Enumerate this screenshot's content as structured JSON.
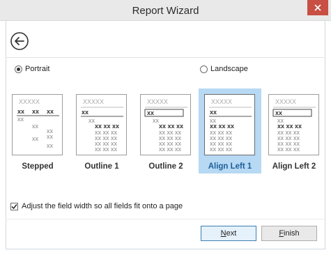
{
  "window": {
    "title": "Report Wizard",
    "close_icon": "close-icon",
    "back_icon": "back-arrow-icon"
  },
  "orientation": {
    "portrait_label": "Portrait",
    "landscape_label": "Landscape",
    "selected": "Portrait"
  },
  "layouts": {
    "items": [
      {
        "label": "Stepped",
        "selected": false
      },
      {
        "label": "Outline 1",
        "selected": false
      },
      {
        "label": "Outline 2",
        "selected": false
      },
      {
        "label": "Align Left 1",
        "selected": true
      },
      {
        "label": "Align Left 2",
        "selected": false
      }
    ],
    "thumb_title": "XXXXX",
    "thumb_short": "xx",
    "thumb_long": "xx xx xx"
  },
  "options": {
    "adjust_width_label": "Adjust the field width so all fields fit onto a page",
    "adjust_width_checked": true
  },
  "buttons": {
    "next_mnemonic": "N",
    "next_rest": "ext",
    "finish_mnemonic": "F",
    "finish_rest": "inish"
  },
  "colors": {
    "selection": "#b7d9f4",
    "accent": "#3c7fb1",
    "close": "#c84f43"
  }
}
